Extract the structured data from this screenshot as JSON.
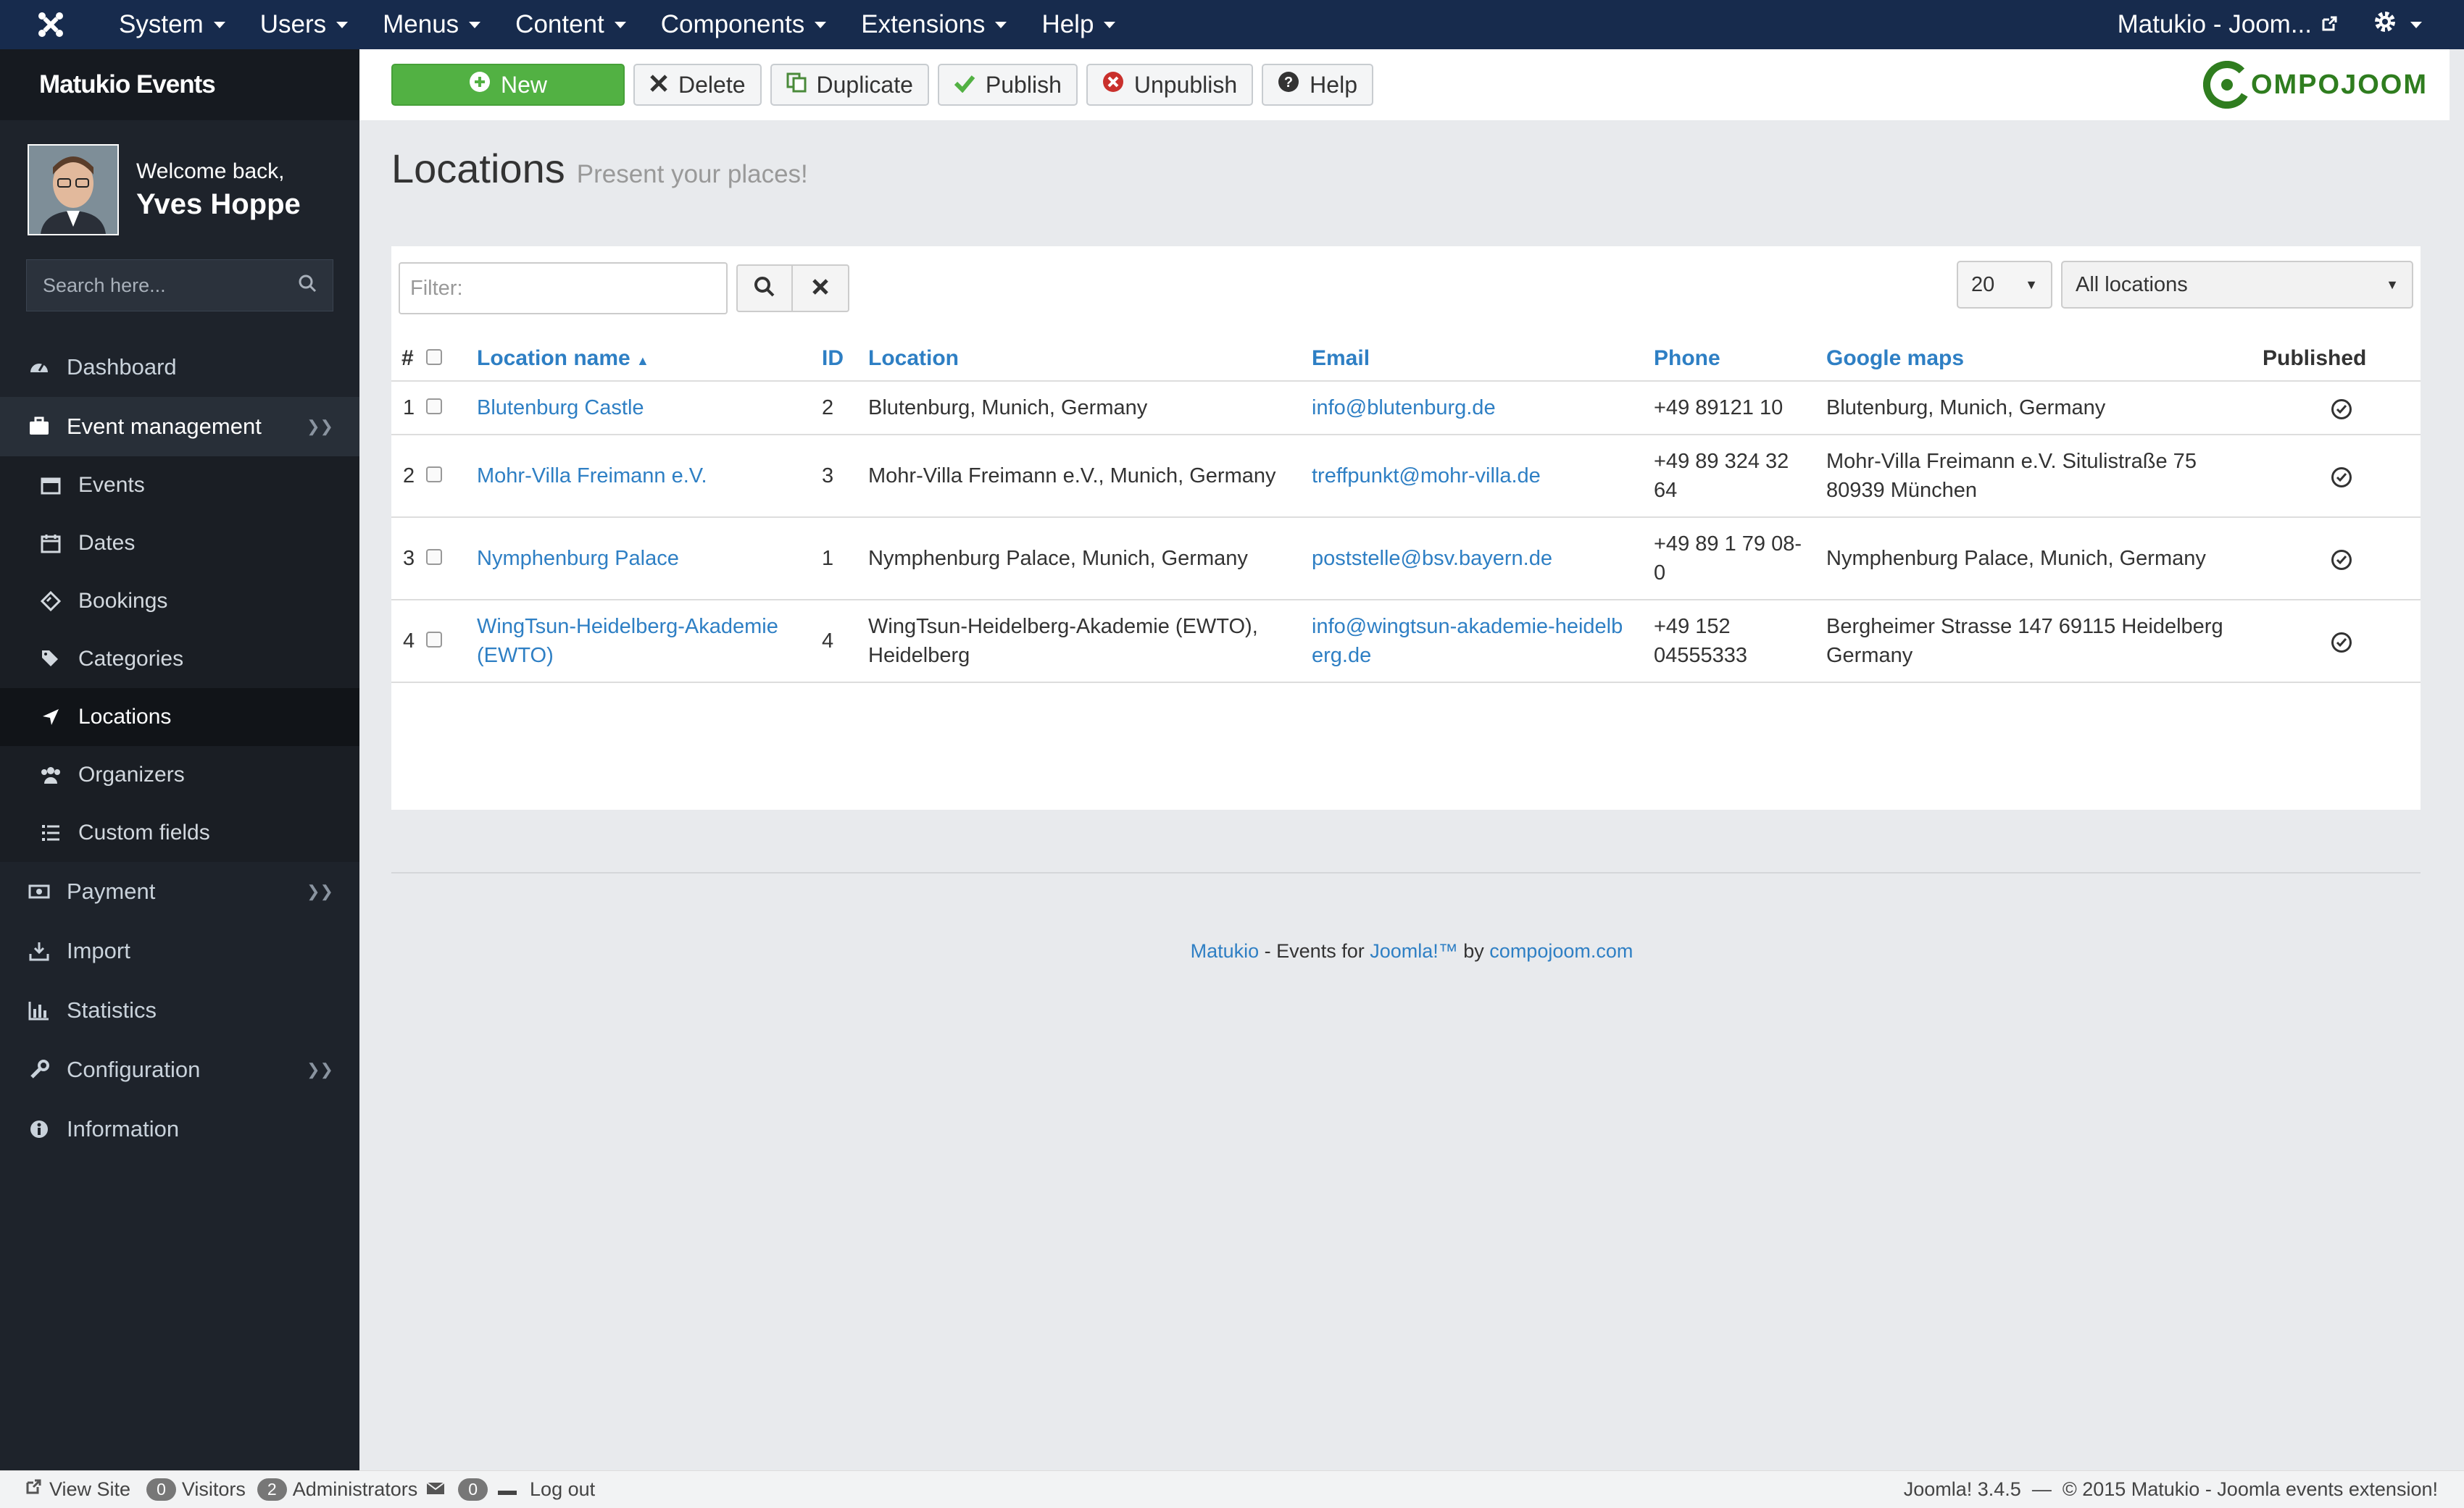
{
  "topnav": {
    "menus": [
      "System",
      "Users",
      "Menus",
      "Content",
      "Components",
      "Extensions",
      "Help"
    ],
    "site_link": "Matukio - Joom..."
  },
  "sidebar": {
    "title": "Matukio Events",
    "welcome": "Welcome back,",
    "user_name": "Yves Hoppe",
    "search_placeholder": "Search here...",
    "items": [
      {
        "label": "Dashboard",
        "icon": "dashboard-icon"
      },
      {
        "label": "Event management",
        "icon": "briefcase-icon"
      },
      {
        "label": "Payment",
        "icon": "money-icon"
      },
      {
        "label": "Import",
        "icon": "download-icon"
      },
      {
        "label": "Statistics",
        "icon": "bar-chart-icon"
      },
      {
        "label": "Configuration",
        "icon": "wrench-icon"
      },
      {
        "label": "Information",
        "icon": "info-icon"
      }
    ],
    "sub_items": [
      {
        "label": "Events",
        "icon": "events-icon"
      },
      {
        "label": "Dates",
        "icon": "calendar-icon"
      },
      {
        "label": "Bookings",
        "icon": "ticket-icon"
      },
      {
        "label": "Categories",
        "icon": "tags-icon"
      },
      {
        "label": "Locations",
        "icon": "location-arrow-icon"
      },
      {
        "label": "Organizers",
        "icon": "users-icon"
      },
      {
        "label": "Custom fields",
        "icon": "list-icon"
      }
    ]
  },
  "toolbar": {
    "new_label": "New",
    "delete_label": "Delete",
    "duplicate_label": "Duplicate",
    "publish_label": "Publish",
    "unpublish_label": "Unpublish",
    "help_label": "Help",
    "brand": "OMPOJOOM",
    "brand_color": "#2f7d1f"
  },
  "page": {
    "title": "Locations",
    "subtitle": "Present your places!"
  },
  "filters": {
    "filter_placeholder": "Filter:",
    "limit": "20",
    "location_select": "All locations"
  },
  "table": {
    "headers": {
      "num": "#",
      "name": "Location name",
      "id": "ID",
      "location": "Location",
      "email": "Email",
      "phone": "Phone",
      "maps": "Google maps",
      "published": "Published"
    },
    "rows": [
      {
        "num": "1",
        "name": "Blutenburg Castle",
        "id": "2",
        "location": "Blutenburg, Munich, Germany",
        "email": "info@blutenburg.de",
        "phone": "+49 89121 10",
        "maps": "Blutenburg, Munich, Germany"
      },
      {
        "num": "2",
        "name": "Mohr-Villa Freimann e.V.",
        "id": "3",
        "location": "Mohr-Villa Freimann e.V., Munich, Germany",
        "email": "treffpunkt@mohr-villa.de",
        "phone": "+49 89 324 32 64",
        "maps": "Mohr-Villa Freimann e.V. Situlistraße 75 80939 München"
      },
      {
        "num": "3",
        "name": "Nymphenburg Palace",
        "id": "1",
        "location": "Nymphenburg Palace, Munich, Germany",
        "email": "poststelle@bsv.bayern.de",
        "phone": "+49 89 1 79 08-0",
        "maps": "Nymphenburg Palace, Munich, Germany"
      },
      {
        "num": "4",
        "name": "WingTsun-Heidelberg-Akademie (EWTO)",
        "id": "4",
        "location": "WingTsun-Heidelberg-Akademie (EWTO), Heidelberg",
        "email": "info@wingtsun-akademie-heidelberg.de",
        "phone": "+49 152 04555333",
        "maps": "Bergheimer Strasse 147 69115 Heidelberg Germany"
      }
    ]
  },
  "footer": {
    "matukio": "Matukio",
    "mid": " - Events for ",
    "joomla": "Joomla!™",
    "by": " by ",
    "compojoom": "compojoom.com"
  },
  "statusbar": {
    "view_site": "View Site",
    "visitors_count": "0",
    "visitors": "Visitors",
    "admins_count": "2",
    "admins": "Administrators",
    "messages_count": "0",
    "logout": "Log out",
    "right": "Joomla! 3.4.5  —  © 2015 Matukio - Joomla events extension!"
  }
}
